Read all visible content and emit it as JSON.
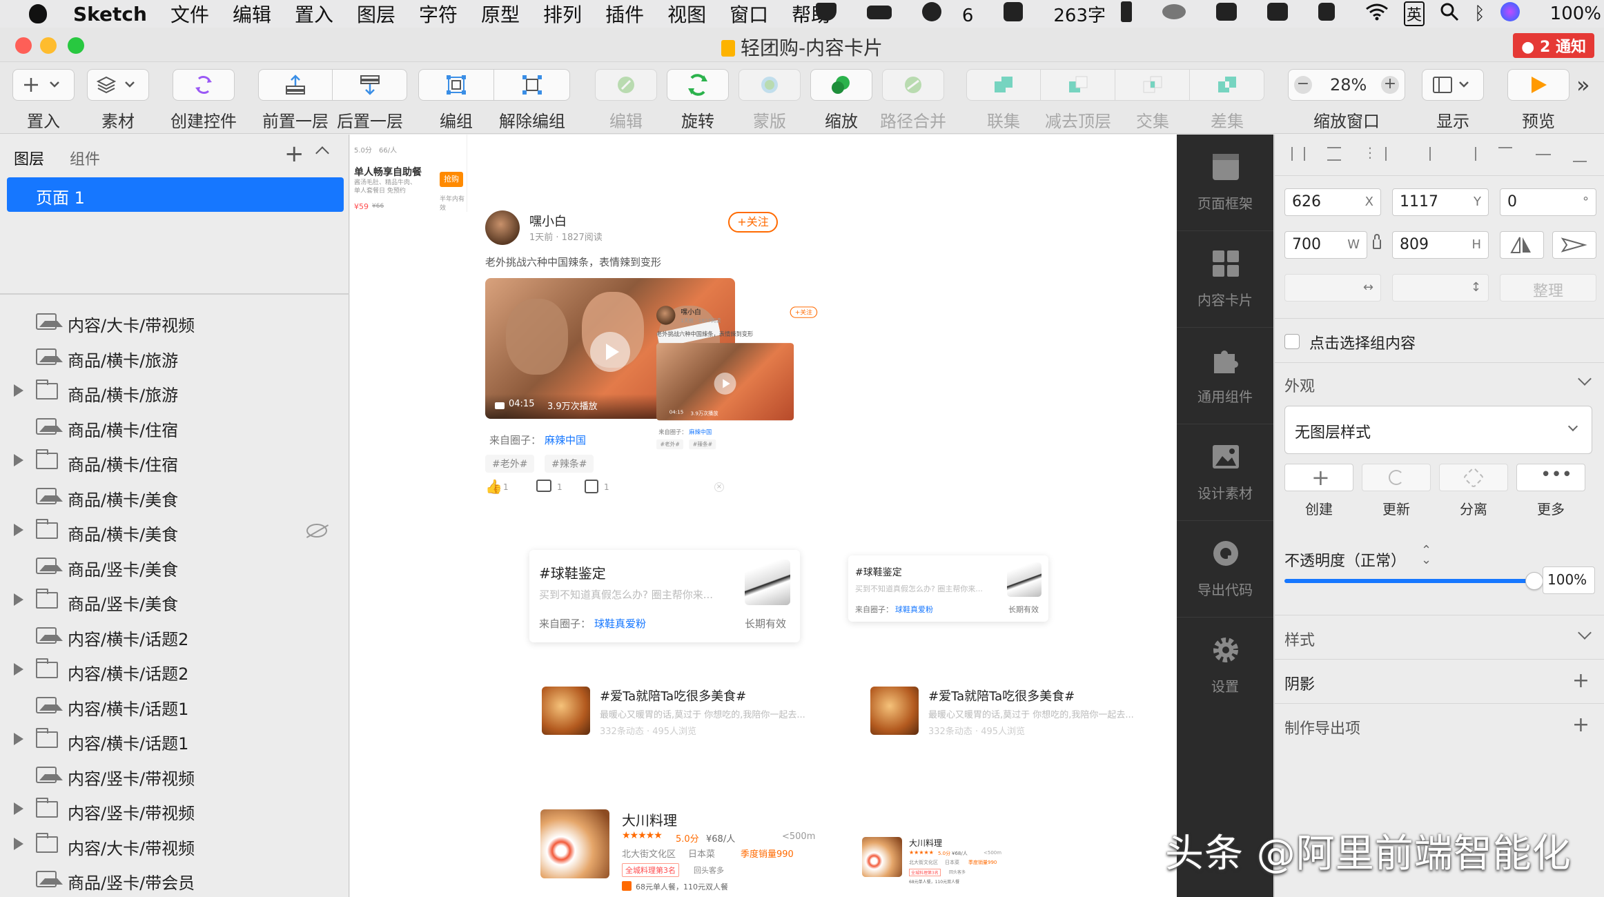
{
  "menubar": {
    "app": "Sketch",
    "items": [
      "文件",
      "编辑",
      "置入",
      "图层",
      "字符",
      "原型",
      "排列",
      "插件",
      "视图",
      "窗口",
      "帮助"
    ],
    "status": {
      "badge_number": "6",
      "word_count": "263字",
      "input_method": "英",
      "battery": "100%"
    }
  },
  "window": {
    "title": "轻团购-内容卡片",
    "notification": "● 2 通知"
  },
  "toolbar": {
    "insert": "置入",
    "assets": "素材",
    "create_symbol": "创建控件",
    "forward": "前置一层",
    "backward": "后置一层",
    "group": "编组",
    "ungroup": "解除编组",
    "edit": "编辑",
    "rotate": "旋转",
    "mask": "蒙版",
    "scale": "缩放",
    "flatten": "路径合并",
    "union": "联集",
    "subtract": "减去顶层",
    "intersect": "交集",
    "difference": "差集",
    "zoom_value": "28%",
    "zoom_label": "缩放窗口",
    "view": "显示",
    "preview": "预览"
  },
  "left_panel": {
    "tab_layers": "图层",
    "tab_components": "组件",
    "page": "页面 1",
    "layers": [
      {
        "name": "内容/大卡/带视频",
        "type": "image"
      },
      {
        "name": "商品/横卡/旅游",
        "type": "image"
      },
      {
        "name": "商品/横卡/旅游",
        "type": "folder"
      },
      {
        "name": "商品/横卡/住宿",
        "type": "image"
      },
      {
        "name": "商品/横卡/住宿",
        "type": "folder"
      },
      {
        "name": "商品/横卡/美食",
        "type": "image"
      },
      {
        "name": "商品/横卡/美食",
        "type": "folder",
        "hidden": true
      },
      {
        "name": "商品/竖卡/美食",
        "type": "image"
      },
      {
        "name": "商品/竖卡/美食",
        "type": "folder"
      },
      {
        "name": "内容/横卡/话题2",
        "type": "image"
      },
      {
        "name": "内容/横卡/话题2",
        "type": "folder"
      },
      {
        "name": "内容/横卡/话题1",
        "type": "image"
      },
      {
        "name": "内容/横卡/话题1",
        "type": "folder"
      },
      {
        "name": "内容/竖卡/带视频",
        "type": "image"
      },
      {
        "name": "内容/竖卡/带视频",
        "type": "folder"
      },
      {
        "name": "内容/大卡/带视频",
        "type": "folder"
      },
      {
        "name": "商品/竖卡/带会员",
        "type": "image"
      }
    ]
  },
  "canvas": {
    "snippet": {
      "rating": "5.0分",
      "price_unit": "66/人",
      "title": "单人畅享自助餐",
      "desc": "酱汤毛肚、精品牛肉、单人套餐日 免预约",
      "price": "¥59",
      "orig_price": "¥66",
      "badge": "抢购",
      "note": "半年内有效"
    },
    "post": {
      "user": "嘿小白",
      "meta": "1天前 · 1827阅读",
      "follow": "+关注",
      "text": "老外挑战六种中国辣条，表情辣到变形",
      "duration": "04:15",
      "plays": "3.9万次播放",
      "from_label": "来自圈子：",
      "circle": "麻辣中国",
      "tags": [
        "#老外#",
        "#辣条#"
      ],
      "likes": "1",
      "comments": "1",
      "shares": "1"
    },
    "topic": {
      "title": "#球鞋鉴定",
      "desc": "买到不知道真假怎么办? 圈主帮你来...",
      "from_label": "来自圈子：",
      "circle": "球鞋真爱粉",
      "validity": "长期有效"
    },
    "food_topic": {
      "title": "#爱Ta就陪Ta吃很多美食#",
      "desc": "最暖心又暖胃的话,莫过于 你想吃的,我陪你一起去...",
      "stats": "332条动态 · 495人浏览"
    },
    "shop": {
      "name": "大川料理",
      "rating": "5.0分",
      "price": "¥68/人",
      "distance": "<500m",
      "area": "北大街文化区",
      "cuisine": "日本菜",
      "sales": "季度销量990",
      "rank": "全城料理第3名",
      "repeat": "回头客多",
      "deal": "68元单人餐，110元双人餐"
    }
  },
  "plugins": [
    "页面框架",
    "内容卡片",
    "通用组件",
    "设计素材",
    "导出代码",
    "设置"
  ],
  "inspector": {
    "x": "626",
    "x_label": "X",
    "y": "1117",
    "y_label": "Y",
    "rotation": "0",
    "rotation_unit": "°",
    "w": "700",
    "w_label": "W",
    "h": "809",
    "h_label": "H",
    "tidy": "整理",
    "click_through": "点击选择组内容",
    "appearance": "外观",
    "layer_style": "无图层样式",
    "style_buttons": [
      "创建",
      "更新",
      "分离",
      "更多"
    ],
    "opacity_label": "不透明度（正常）",
    "opacity": "100%",
    "opacity_fraction": 1.0,
    "style": "样式",
    "shadow": "阴影",
    "export": "制作导出项"
  },
  "watermark": "头条 @阿里前端智能化",
  "colors": {
    "accent": "#1677ff",
    "orange": "#ff6a00",
    "link": "#1677ff",
    "dark_panel": "#2b2b2b"
  }
}
